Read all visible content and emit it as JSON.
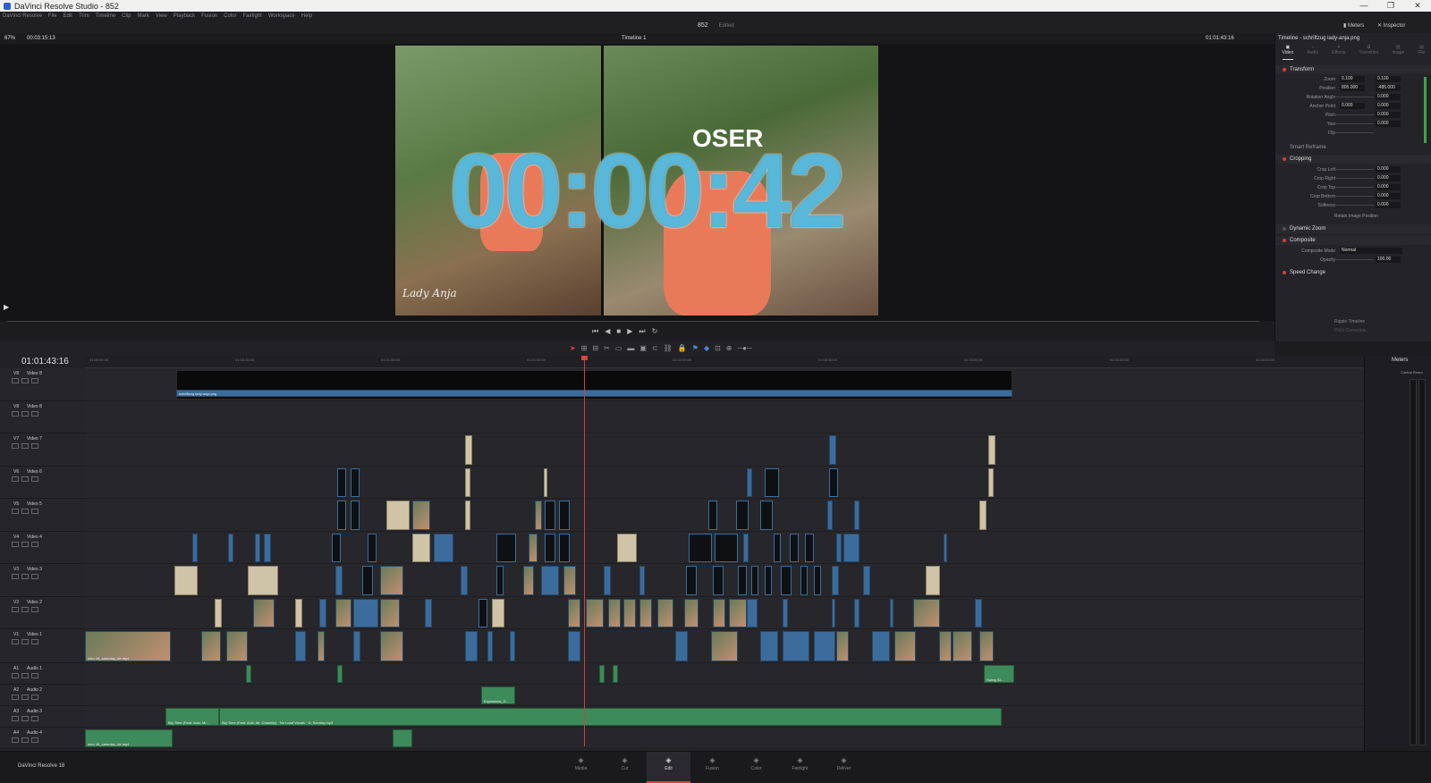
{
  "window": {
    "title": "DaVinci Resolve Studio - 852",
    "controls": [
      "—",
      "❐",
      "✕"
    ]
  },
  "menu": [
    "DaVinci Resolve",
    "File",
    "Edit",
    "Trim",
    "Timeline",
    "Clip",
    "Mark",
    "View",
    "Playback",
    "Fusion",
    "Color",
    "Fairlight",
    "Workspace",
    "Help"
  ],
  "project": {
    "name": "852",
    "status": "Edited",
    "meters_label": "Meters",
    "inspector_label": "Inspector"
  },
  "viewer": {
    "zoom": "67%",
    "source_tc": "00:03:15:13",
    "timeline_name": "Timeline 1",
    "record_tc": "01:01:43:16",
    "overlay_tc": "00:00:42",
    "overlay_text": "OSER",
    "signature": "Lady Anja"
  },
  "inspector": {
    "title": "Timeline - schriftzug lady-anja.png",
    "tabs": [
      "Video",
      "Audio",
      "Effects",
      "Transition",
      "Image",
      "File"
    ],
    "sections": {
      "transform": "Transform",
      "smart_reframe": "Smart Reframe",
      "cropping": "Cropping",
      "dynamic_zoom": "Dynamic Zoom",
      "composite": "Composite",
      "speed_change": "Speed Change"
    },
    "transform_props": [
      {
        "label": "Zoom",
        "x": "0.100",
        "y": "0.100"
      },
      {
        "label": "Position",
        "x": "805.000",
        "y": "-485.000"
      },
      {
        "label": "Rotation Angle",
        "x": "",
        "y": "0.000"
      },
      {
        "label": "Anchor Point",
        "x": "0.000",
        "y": "0.000"
      },
      {
        "label": "Pitch",
        "x": "",
        "y": "0.000"
      },
      {
        "label": "Yaw",
        "x": "",
        "y": "0.000"
      },
      {
        "label": "Flip",
        "x": "",
        "y": ""
      }
    ],
    "crop_props": [
      {
        "label": "Crop Left",
        "v": "0.000"
      },
      {
        "label": "Crop Right",
        "v": "0.000"
      },
      {
        "label": "Crop Top",
        "v": "0.000"
      },
      {
        "label": "Crop Bottom",
        "v": "0.000"
      },
      {
        "label": "Softness",
        "v": "0.000"
      }
    ],
    "retain": "Retain Image Position",
    "composite_mode_label": "Composite Mode",
    "composite_mode": "Normal",
    "opacity_label": "Opacity",
    "opacity": "100.00",
    "ripple": "Ripple Timeline",
    "pitch_correction": "Pitch Correction"
  },
  "timeline": {
    "timecode": "01:01:43:16",
    "ruler": [
      "01:00:00:00",
      "01:00:30:00",
      "01:01:00:00",
      "01:01:30:00",
      "01:02:00:00",
      "01:02:30:00",
      "01:03:00:00",
      "01:03:30:00",
      "01:04:00:00",
      "01:04:30:00"
    ],
    "tracks": [
      {
        "id": "V8",
        "name": "Video 8"
      },
      {
        "id": "V8",
        "name": "Video 8"
      },
      {
        "id": "V7",
        "name": "Video 7"
      },
      {
        "id": "V6",
        "name": "Video 6"
      },
      {
        "id": "V5",
        "name": "Video 5"
      },
      {
        "id": "V4",
        "name": "Video 4"
      },
      {
        "id": "V3",
        "name": "Video 3"
      },
      {
        "id": "V2",
        "name": "Video 2"
      },
      {
        "id": "V1",
        "name": "Video 1"
      },
      {
        "id": "A1",
        "name": "Audio 1"
      },
      {
        "id": "A2",
        "name": "Audio 2"
      },
      {
        "id": "A3",
        "name": "Audio 3"
      },
      {
        "id": "A4",
        "name": "Audio 4"
      }
    ],
    "clip_labels": {
      "title_track": "schriftzug lady-anja.png",
      "v1_intro": "intro 18_saturday_de.mp4",
      "a3_clip1": "Big Time (Feat. Aoki, Mr...",
      "a3_clip2": "Big Time (Feat. Aoki, Mr. Chamilly) · No Load Vocals · G. Scoring.mp3",
      "a4_clip": "intro 18_saturday_de.mp4",
      "a2_clip": "Explosions_G...",
      "a1_clip": "Swing 02..."
    }
  },
  "meters": {
    "title": "Meters",
    "label": "Control Room"
  },
  "pages": {
    "brand": "DaVinci Resolve 18",
    "items": [
      {
        "label": "Media",
        "icon": "media-icon"
      },
      {
        "label": "Cut",
        "icon": "cut-icon"
      },
      {
        "label": "Edit",
        "icon": "edit-icon"
      },
      {
        "label": "Fusion",
        "icon": "fusion-icon"
      },
      {
        "label": "Color",
        "icon": "color-icon"
      },
      {
        "label": "Fairlight",
        "icon": "fairlight-icon"
      },
      {
        "label": "Deliver",
        "icon": "deliver-icon"
      }
    ],
    "active": "Edit"
  }
}
